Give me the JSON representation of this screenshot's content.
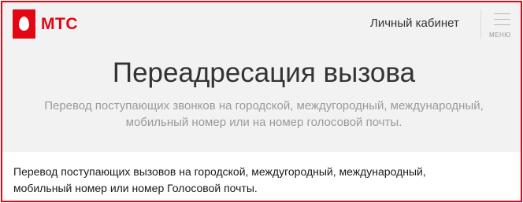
{
  "header": {
    "logo_text": "МТС",
    "cabinet_link": "Личный кабинет",
    "menu_label": "МЕНЮ"
  },
  "hero": {
    "title": "Переадресация вызова",
    "subtitle_line1": "Перевод поступающих звонков на городской, междугородный, международный,",
    "subtitle_line2": "мобильный номер или на номер голосовой почты."
  },
  "body": {
    "description_line1": "Перевод поступающих вызовов на городской, междугородный, международный,",
    "description_line2": "мобильный номер или номер Голосовой почты."
  },
  "colors": {
    "brand": "#e30613",
    "hero_background": "#f2f2f2"
  }
}
